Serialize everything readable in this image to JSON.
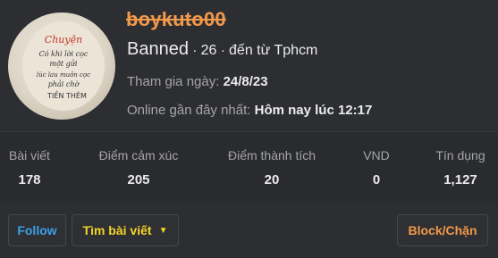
{
  "profile": {
    "username": "boykuto00",
    "title": "Banned",
    "age": "26",
    "location_prefix": "đến từ",
    "location": "Tphcm",
    "joined_label": "Tham gia ngày:",
    "joined_value": "24/8/23",
    "online_label": "Online gần đây nhất:",
    "online_value": "Hôm nay lúc 12:17"
  },
  "avatar": {
    "text_lines": [
      "Chuyện",
      "Có khi lời cọc",
      "một gửi",
      "lúc lau muôn cọc",
      "phải chờ",
      "TIỀN THÊM"
    ]
  },
  "stats": [
    {
      "label": "Bài viết",
      "value": "178"
    },
    {
      "label": "Điểm cảm xúc",
      "value": "205"
    },
    {
      "label": "Điểm thành tích",
      "value": "20"
    },
    {
      "label": "VND",
      "value": "0"
    },
    {
      "label": "Tín dụng",
      "value": "1,127"
    }
  ],
  "actions": {
    "follow": "Follow",
    "find_posts": "Tìm bài viết",
    "block": "Block/Chặn"
  },
  "colors": {
    "username": "#f2994a",
    "follow": "#3aa0e8",
    "find_posts": "#f5d327",
    "block": "#f2994a",
    "background": "#2d2e32"
  }
}
